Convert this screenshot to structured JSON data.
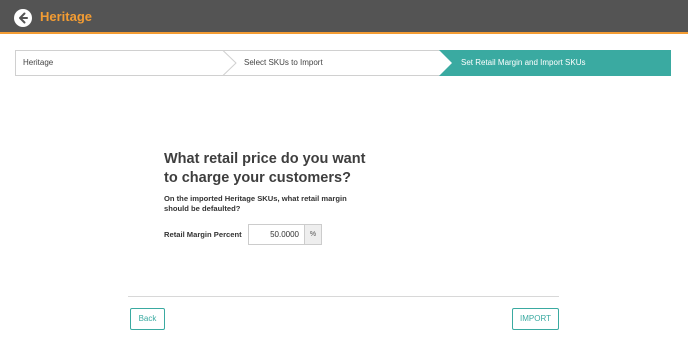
{
  "header": {
    "title": "Heritage",
    "back_icon": "back-arrow-circle-icon"
  },
  "wizard": {
    "steps": [
      {
        "label": "Heritage",
        "active": false
      },
      {
        "label": "Select SKUs to Import",
        "active": false
      },
      {
        "label": "Set Retail Margin and Import SKUs",
        "active": true
      }
    ],
    "active_color": "#3aaaa1"
  },
  "main": {
    "question_line1": "What retail price do you want",
    "question_line2": "to charge your customers?",
    "subtext_line1": "On the imported Heritage SKUs, what retail margin",
    "subtext_line2": "should be defaulted?",
    "field": {
      "label": "Retail Margin Percent",
      "value": "50.0000",
      "unit": "%"
    }
  },
  "footer": {
    "back_label": "Back",
    "import_label": "IMPORT"
  },
  "colors": {
    "header_bg": "#545454",
    "brand_orange": "#f39c33",
    "accent_teal": "#3aaaa1"
  }
}
